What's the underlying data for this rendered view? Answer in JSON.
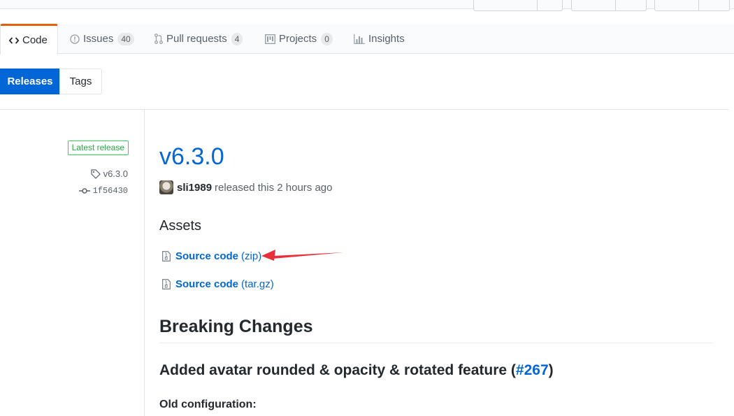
{
  "nav": {
    "tabs": [
      {
        "label": "Code",
        "icon": "code-icon",
        "selected": true
      },
      {
        "label": "Issues",
        "count": "40",
        "icon": "issue-icon"
      },
      {
        "label": "Pull requests",
        "count": "4",
        "icon": "pull-request-icon"
      },
      {
        "label": "Projects",
        "count": "0",
        "icon": "project-icon"
      },
      {
        "label": "Insights",
        "icon": "graph-icon"
      }
    ]
  },
  "subnav": {
    "releases": "Releases",
    "tags": "Tags"
  },
  "release": {
    "latest_badge": "Latest release",
    "tag": "v6.3.0",
    "commit": "1f56430",
    "title": "v6.3.0",
    "author": "sli1989",
    "released_text": "released this 2 hours ago"
  },
  "assets": {
    "heading": "Assets",
    "items": [
      {
        "name": "Source code",
        "format": "(zip)"
      },
      {
        "name": "Source code",
        "format": "(tar.gz)"
      }
    ]
  },
  "notes": {
    "breaking_heading": "Breaking Changes",
    "feature_heading_prefix": "Added avatar rounded & opacity & rotated feature (",
    "feature_issue": "#267",
    "feature_heading_suffix": ")",
    "old_config_label": "Old configuration:"
  },
  "colors": {
    "accent": "#0366d6",
    "tab_highlight": "#e36209",
    "latest_green": "#28a745",
    "annotation_arrow": "#e8303a"
  }
}
